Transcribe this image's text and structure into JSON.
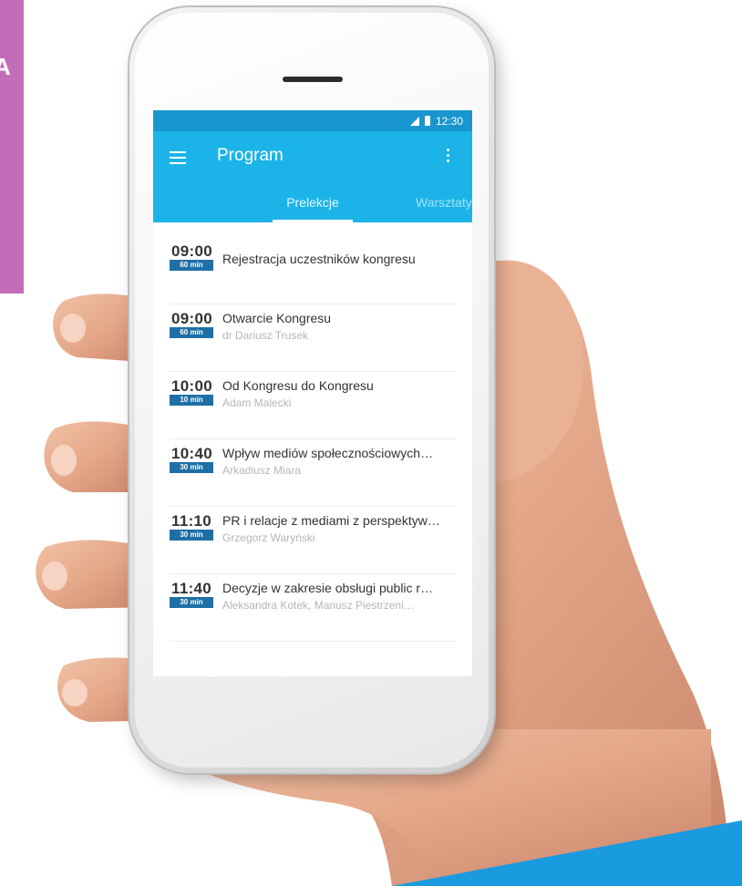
{
  "status_bar": {
    "time": "12:30"
  },
  "app_bar": {
    "title": "Program"
  },
  "tabs": [
    {
      "label": "Prelekcje",
      "active": true
    },
    {
      "label": "Warsztaty",
      "active": false
    }
  ],
  "sessions": [
    {
      "time": "09:00",
      "duration": "60 min",
      "title": "Rejestracja uczestników kongresu",
      "speaker": ""
    },
    {
      "time": "09:00",
      "duration": "60 min",
      "title": "Otwarcie Kongresu",
      "speaker": "dr Dariusz Trusek"
    },
    {
      "time": "10:00",
      "duration": "10 min",
      "title": "Od Kongresu do Kongresu",
      "speaker": "Adam Malecki"
    },
    {
      "time": "10:40",
      "duration": "30 min",
      "title": "Wpływ mediów społecznościowych…",
      "speaker": "Arkadiusz Miara"
    },
    {
      "time": "11:10",
      "duration": "30 min",
      "title": "PR i relacje z mediami z perspektyw…",
      "speaker": "Grzegorz Waryński"
    },
    {
      "time": "11:40",
      "duration": "30 min",
      "title": "Decyzje w zakresie obsługi public r…",
      "speaker": "Aleksandra Kotek, Mariusz Piestrzeni…"
    }
  ],
  "background": {
    "purple_letter": "A"
  },
  "colors": {
    "status_bar": "#1a96cf",
    "app_bar": "#1cb4e8",
    "duration_badge": "#1f6fa6",
    "purple_block": "#c46cb8",
    "corner_accent": "#1a9be0"
  }
}
